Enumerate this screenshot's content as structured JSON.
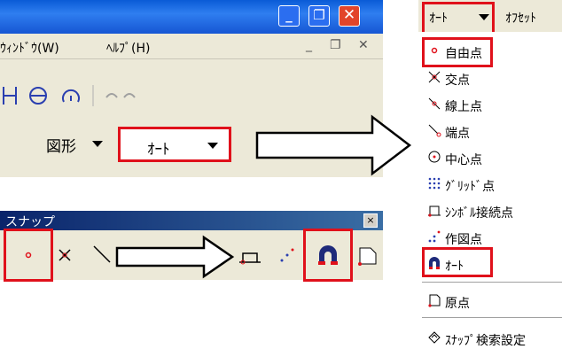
{
  "window": {
    "menu_window": "ｳｨﾝﾄﾞｳ(W)",
    "menu_help": "ﾍﾙﾌﾟ(H)"
  },
  "toolbar": {
    "shape_label": "図形",
    "auto_label": "ｵｰﾄ"
  },
  "snap_toolbar": {
    "title": "スナップ",
    "close_label": "×"
  },
  "right_menu": {
    "header_auto": "ｵｰﾄ",
    "header_offset": "ｵﾌｾｯﾄ",
    "items": [
      {
        "label": "自由点",
        "icon": "dot-icon"
      },
      {
        "label": "交点",
        "icon": "intersection-icon"
      },
      {
        "label": "線上点",
        "icon": "on-line-point-icon"
      },
      {
        "label": "端点",
        "icon": "endpoint-icon"
      },
      {
        "label": "中心点",
        "icon": "center-point-icon"
      },
      {
        "label": "ｸﾞﾘｯﾄﾞ点",
        "icon": "grid-point-icon"
      },
      {
        "label": "ｼﾝﾎﾞﾙ接続点",
        "icon": "symbol-connection-icon"
      },
      {
        "label": "作図点",
        "icon": "construction-point-icon"
      },
      {
        "label": "ｵｰﾄ",
        "icon": "auto-magnet-icon"
      },
      {
        "label": "原点",
        "icon": "origin-icon"
      },
      {
        "label": "ｽﾅｯﾌﾟ検索設定",
        "icon": "snap-settings-icon"
      }
    ]
  },
  "colors": {
    "highlight_red": "#e0111b",
    "xp_title_blue": "#0a5bd6",
    "snap_point_red": "#e0111b"
  }
}
